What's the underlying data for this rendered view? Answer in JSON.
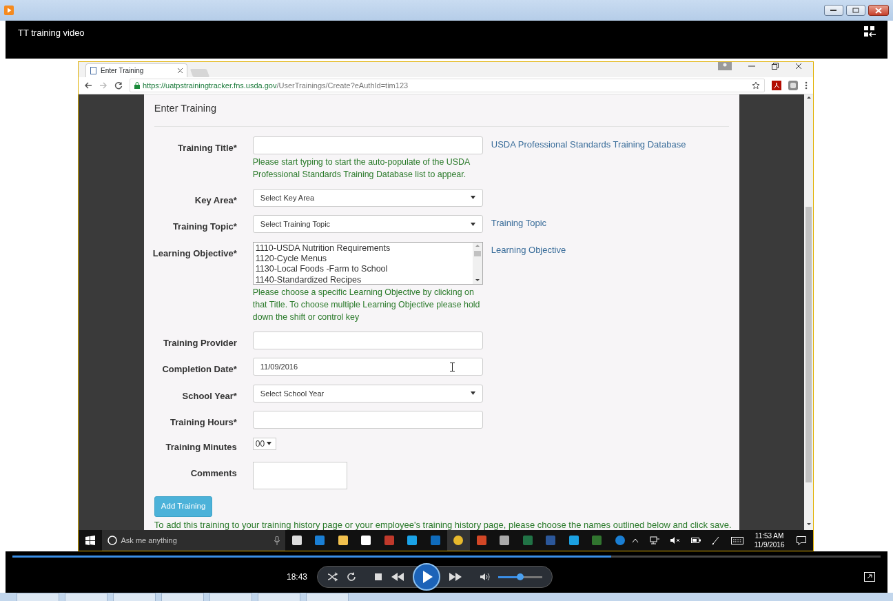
{
  "player": {
    "title": "TT training video",
    "time": "18:43",
    "progress": {
      "level": 0.69
    },
    "volume": {
      "level": 0.5
    }
  },
  "browser": {
    "tab": "Enter Training",
    "url_host": "https://uatpstrainingtracker.fns.usda.gov",
    "url_path": "/UserTrainings/Create?eAuthId=tim123"
  },
  "page": {
    "heading": "Enter Training",
    "fields": [
      {
        "kind": "text",
        "label": "Training Title*",
        "hint": "Please start typing to start the auto-populate of the USDA Professional Standards Training Database list to appear.",
        "link": "USDA Professional Standards Training Database"
      },
      {
        "kind": "select",
        "label": "Key Area*",
        "value": "Select Key Area"
      },
      {
        "kind": "select",
        "label": "Training Topic*",
        "value": "Select Training Topic",
        "link": "Training Topic"
      },
      {
        "kind": "listbox",
        "label": "Learning Objective*",
        "options": [
          "1110-USDA Nutrition Requirements",
          "1120-Cycle Menus",
          "1130-Local Foods -Farm to School",
          "1140-Standardized Recipes"
        ],
        "hint": "Please choose a specific Learning Objective by clicking on that Title. To choose multiple Learning Objective please hold down the shift or control key",
        "link": "Learning Objective"
      },
      {
        "kind": "text",
        "label": "Training Provider"
      },
      {
        "kind": "text",
        "label": "Completion Date*",
        "value": "11/09/2016"
      },
      {
        "kind": "select",
        "label": "School Year*",
        "value": "Select School Year"
      },
      {
        "kind": "text",
        "label": "Training Hours*"
      },
      {
        "kind": "mini",
        "label": "Training Minutes",
        "value": "00"
      },
      {
        "kind": "textarea",
        "label": "Comments"
      }
    ],
    "button": "Add Training",
    "note": "To add this training to your training history page or your employee's training history page, please choose the names outlined below and click save."
  },
  "taskbar": {
    "search": "Ask me anything",
    "time": "11:53 AM",
    "date": "11/9/2016"
  }
}
